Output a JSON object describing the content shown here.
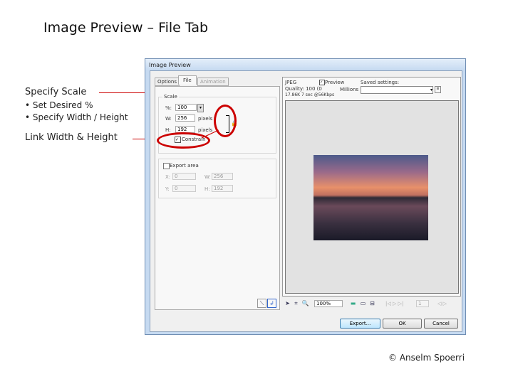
{
  "slide": {
    "title": "Image Preview – File Tab",
    "credit": "© Anselm Spoerri"
  },
  "notes": {
    "specify_scale": "Specify Scale",
    "bullets": [
      "• Set Desired %",
      "• Specify Width / Height"
    ],
    "link": "Link Width & Height"
  },
  "dialog": {
    "title": "Image Preview",
    "tabs": [
      "Options",
      "File",
      "Animation"
    ],
    "scale": {
      "label": "Scale",
      "pct_label": "%:",
      "pct": "100",
      "w_label": "W:",
      "w": "256",
      "h_label": "H:",
      "h": "192",
      "unit": "pixels",
      "constrain": "Constrain"
    },
    "export_area": {
      "label": "Export area",
      "x_label": "X:",
      "x": "0",
      "y_label": "Y:",
      "y": "0",
      "w_label": "W:",
      "w": "256",
      "h_label": "H:",
      "h": "192"
    },
    "info": {
      "format": "JPEG",
      "preview": "Preview",
      "quality": "Quality: 100 (0",
      "size": "17.86K 7 sec @56Kbps",
      "millions": "Millions",
      "saved_settings": "Saved settings:"
    },
    "zoom": "100%",
    "frame": "1",
    "buttons": {
      "export": "Export...",
      "ok": "OK",
      "cancel": "Cancel"
    }
  },
  "colors": {
    "annotation": "#cc0000"
  }
}
